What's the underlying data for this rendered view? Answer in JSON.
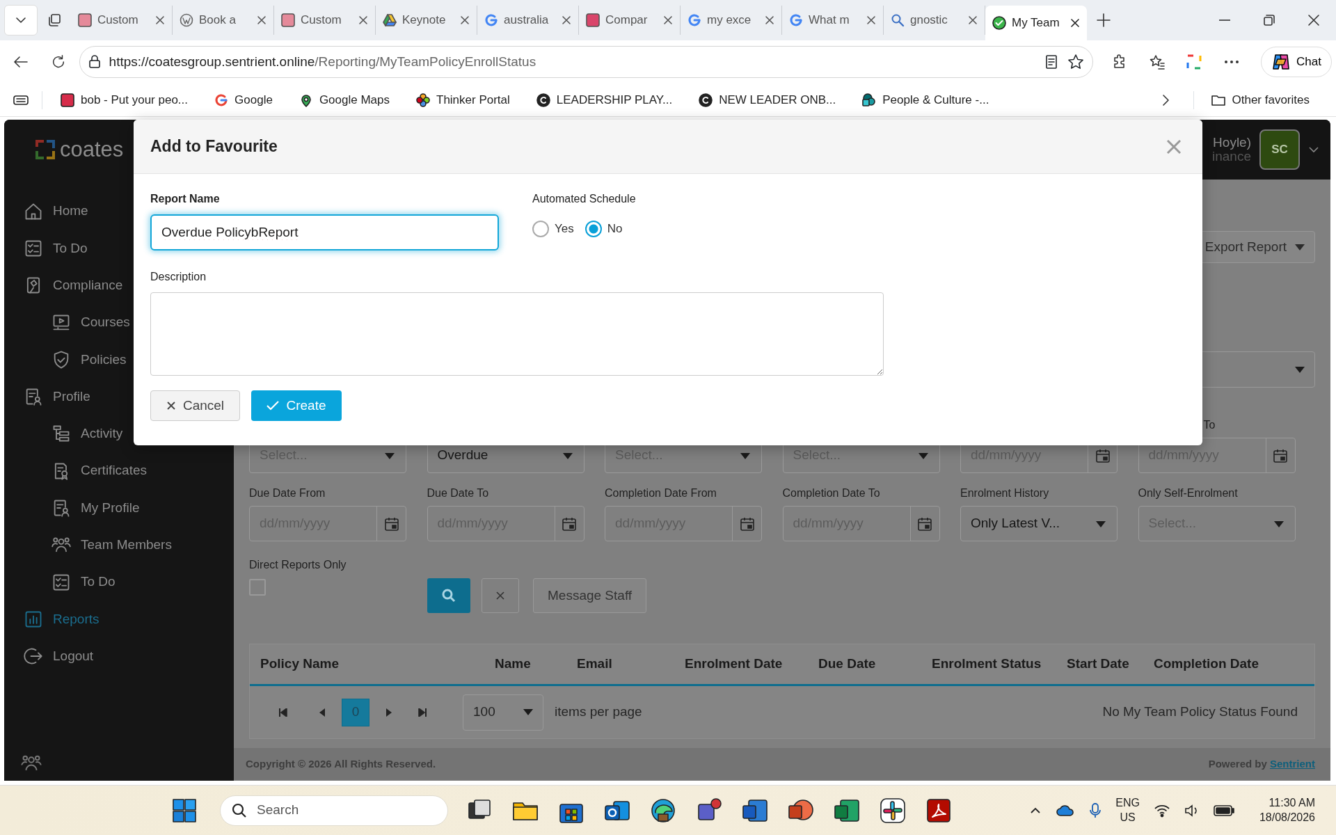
{
  "browser": {
    "tabs": [
      {
        "title": "Custom",
        "selected": false
      },
      {
        "title": "Book a",
        "selected": false
      },
      {
        "title": "Custom",
        "selected": false
      },
      {
        "title": "Keynote",
        "selected": false
      },
      {
        "title": "australia",
        "selected": false
      },
      {
        "title": "Compar",
        "selected": false
      },
      {
        "title": "my exce",
        "selected": false
      },
      {
        "title": "What m",
        "selected": false
      },
      {
        "title": "gnostic",
        "selected": false
      },
      {
        "title": "My Team",
        "selected": true
      }
    ],
    "url": {
      "host": "https://coatesgroup.sentrient.online",
      "path": "/Reporting/MyTeamPolicyEnrollStatus"
    },
    "chat_button": "Chat",
    "bookmarks": [
      "bob - Put your peo...",
      "Google",
      "Google Maps",
      "Thinker Portal",
      "LEADERSHIP PLAY...",
      "NEW LEADER ONB...",
      "People & Culture -..."
    ],
    "other_favorites": "Other favorites"
  },
  "app": {
    "logo": "coates",
    "user": {
      "name": "Hoyle)",
      "role": "inance",
      "initials": "SC"
    },
    "sidebar": {
      "items": [
        {
          "label": "Home",
          "selected": false
        },
        {
          "label": "To Do",
          "selected": false
        },
        {
          "label": "Compliance",
          "selected": false,
          "children": [
            {
              "label": "Courses",
              "selected": false
            },
            {
              "label": "Policies",
              "selected": false
            }
          ]
        },
        {
          "label": "Profile",
          "selected": false,
          "children": [
            {
              "label": "Activity",
              "selected": false
            },
            {
              "label": "Certificates",
              "selected": false
            },
            {
              "label": "My Profile",
              "selected": false
            },
            {
              "label": "Team Members",
              "selected": false
            },
            {
              "label": "To Do",
              "selected": false
            }
          ]
        },
        {
          "label": "Reports",
          "selected": true
        },
        {
          "label": "Logout",
          "selected": false
        }
      ]
    },
    "export_button": "Export Report",
    "filters": [
      [
        {
          "kind": "select",
          "placeholder": "Select..."
        },
        {
          "kind": "select",
          "value": "Overdue"
        },
        {
          "kind": "select",
          "placeholder": "Select..."
        },
        {
          "kind": "select",
          "placeholder": "Select..."
        },
        {
          "kind": "date",
          "placeholder": "dd/mm/yyyy"
        },
        {
          "kind": "date",
          "label": "To",
          "placeholder": "dd/mm/yyyy"
        }
      ],
      [
        {
          "kind": "date",
          "label": "Due Date From",
          "placeholder": "dd/mm/yyyy"
        },
        {
          "kind": "date",
          "label": "Due Date To",
          "placeholder": "dd/mm/yyyy"
        },
        {
          "kind": "date",
          "label": "Completion Date From",
          "placeholder": "dd/mm/yyyy"
        },
        {
          "kind": "date",
          "label": "Completion Date To",
          "placeholder": "dd/mm/yyyy"
        },
        {
          "kind": "select",
          "label": "Enrolment History",
          "value": "Only Latest V..."
        },
        {
          "kind": "select",
          "label": "Only Self-Enrolment",
          "placeholder": "Select..."
        }
      ]
    ],
    "direct_reports": {
      "label": "Direct Reports Only",
      "checked": false
    },
    "message_button": "Message Staff",
    "table": {
      "columns": [
        "Policy Name",
        "Name",
        "Email",
        "Enrolment Date",
        "Due Date",
        "Enrolment Status",
        "Start Date",
        "Completion Date"
      ],
      "pager": {
        "page": "0",
        "per_page": "100",
        "per_page_label": "items per page"
      },
      "empty_message": "No My Team Policy Status Found"
    },
    "footer": {
      "copyright": "Copyright © 2026 All Rights Reserved.",
      "powered_by": "Powered by",
      "brand": "Sentrient"
    }
  },
  "modal": {
    "title": "Add to Favourite",
    "report_name": {
      "label": "Report Name",
      "value": "Overdue PolicybReport"
    },
    "schedule": {
      "label": "Automated Schedule",
      "options": [
        {
          "label": "Yes",
          "selected": false
        },
        {
          "label": "No",
          "selected": true
        }
      ]
    },
    "description": {
      "label": "Description"
    },
    "buttons": {
      "cancel": "Cancel",
      "create": "Create"
    }
  },
  "taskbar": {
    "search_placeholder": "Search",
    "language": "ENG",
    "region": "US",
    "time": "11:30 AM",
    "date": "18/08/2026"
  }
}
